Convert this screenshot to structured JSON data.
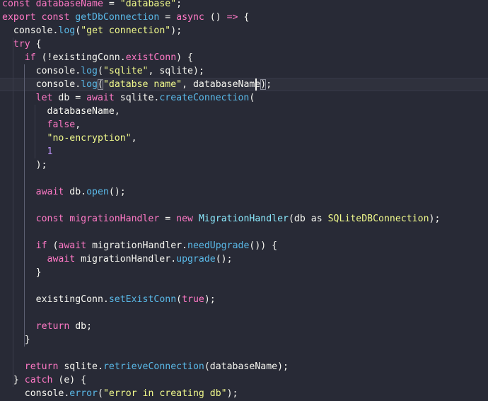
{
  "editor": {
    "colors": {
      "background": "#282a36",
      "keyword": "#ff79c6",
      "variable": "#ff79c6",
      "string": "#f1fa8c",
      "function": "#5ab9e8",
      "class": "#8be9fd",
      "plain": "#f8f8f2",
      "boolean": "#bd93f9",
      "punctuation": "#f8f8f2"
    },
    "lines": [
      [
        {
          "t": "const ",
          "c": "keyword"
        },
        {
          "t": "databaseName",
          "c": "variable"
        },
        {
          "t": " = ",
          "c": "plain"
        },
        {
          "t": "\"database\"",
          "c": "string"
        },
        {
          "t": ";",
          "c": "plain"
        }
      ],
      [
        {
          "t": "export",
          "c": "keyword"
        },
        {
          "t": " const ",
          "c": "keyword"
        },
        {
          "t": "getDbConnection",
          "c": "function"
        },
        {
          "t": " = ",
          "c": "plain"
        },
        {
          "t": "async",
          "c": "keyword"
        },
        {
          "t": " () ",
          "c": "plain"
        },
        {
          "t": "=>",
          "c": "keyword"
        },
        {
          "t": " {",
          "c": "plain"
        }
      ],
      [
        {
          "t": "  console",
          "c": "plain"
        },
        {
          "t": ".",
          "c": "plain"
        },
        {
          "t": "log",
          "c": "function"
        },
        {
          "t": "(",
          "c": "plain"
        },
        {
          "t": "\"get connection\"",
          "c": "string"
        },
        {
          "t": ");",
          "c": "plain"
        }
      ],
      [
        {
          "t": "  try",
          "c": "keyword"
        },
        {
          "t": " {",
          "c": "plain"
        }
      ],
      [
        {
          "t": "    if",
          "c": "keyword"
        },
        {
          "t": " (!existingConn.",
          "c": "plain"
        },
        {
          "t": "existConn",
          "c": "keyword"
        },
        {
          "t": ") {",
          "c": "plain"
        }
      ],
      [
        {
          "t": "      console",
          "c": "plain"
        },
        {
          "t": ".",
          "c": "plain"
        },
        {
          "t": "log",
          "c": "function"
        },
        {
          "t": "(",
          "c": "plain"
        },
        {
          "t": "\"sqlite\"",
          "c": "string"
        },
        {
          "t": ", sqlite);",
          "c": "plain"
        }
      ],
      [
        {
          "t": "      console",
          "c": "plain"
        },
        {
          "t": ".",
          "c": "plain"
        },
        {
          "t": "log",
          "c": "function"
        },
        {
          "t": "(",
          "c": "plain",
          "m": true
        },
        {
          "t": "\"databse name\"",
          "c": "string"
        },
        {
          "t": ", databaseName",
          "c": "plain"
        },
        {
          "t": ")",
          "c": "plain",
          "m": true
        },
        {
          "t": ";",
          "c": "plain"
        }
      ],
      [
        {
          "t": "      let",
          "c": "keyword"
        },
        {
          "t": " db = ",
          "c": "plain"
        },
        {
          "t": "await",
          "c": "keyword"
        },
        {
          "t": " sqlite.",
          "c": "plain"
        },
        {
          "t": "createConnection",
          "c": "function"
        },
        {
          "t": "(",
          "c": "plain"
        }
      ],
      [
        {
          "t": "        databaseName,",
          "c": "plain"
        }
      ],
      [
        {
          "t": "        false",
          "c": "keyword"
        },
        {
          "t": ",",
          "c": "plain"
        }
      ],
      [
        {
          "t": "        \"no-encryption\"",
          "c": "string"
        },
        {
          "t": ",",
          "c": "plain"
        }
      ],
      [
        {
          "t": "        1",
          "c": "boolean"
        }
      ],
      [
        {
          "t": "      );",
          "c": "plain"
        }
      ],
      [],
      [
        {
          "t": "      await",
          "c": "keyword"
        },
        {
          "t": " db.",
          "c": "plain"
        },
        {
          "t": "open",
          "c": "function"
        },
        {
          "t": "();",
          "c": "plain"
        }
      ],
      [],
      [
        {
          "t": "      const ",
          "c": "keyword"
        },
        {
          "t": "migrationHandler",
          "c": "variable"
        },
        {
          "t": " = ",
          "c": "plain"
        },
        {
          "t": "new",
          "c": "keyword"
        },
        {
          "t": " ",
          "c": "plain"
        },
        {
          "t": "MigrationHandler",
          "c": "class"
        },
        {
          "t": "(db ",
          "c": "plain"
        },
        {
          "t": "as",
          "c": "plain"
        },
        {
          "t": " ",
          "c": "plain"
        },
        {
          "t": "SQLiteDBConnection",
          "c": "string"
        },
        {
          "t": ");",
          "c": "plain"
        }
      ],
      [],
      [
        {
          "t": "      if",
          "c": "keyword"
        },
        {
          "t": " (",
          "c": "plain"
        },
        {
          "t": "await",
          "c": "keyword"
        },
        {
          "t": " migrationHandler.",
          "c": "plain"
        },
        {
          "t": "needUpgrade",
          "c": "function"
        },
        {
          "t": "()) {",
          "c": "plain"
        }
      ],
      [
        {
          "t": "        await",
          "c": "keyword"
        },
        {
          "t": " migrationHandler.",
          "c": "plain"
        },
        {
          "t": "upgrade",
          "c": "function"
        },
        {
          "t": "();",
          "c": "plain"
        }
      ],
      [
        {
          "t": "      }",
          "c": "plain"
        }
      ],
      [],
      [
        {
          "t": "      existingConn.",
          "c": "plain"
        },
        {
          "t": "setExistConn",
          "c": "function"
        },
        {
          "t": "(",
          "c": "plain"
        },
        {
          "t": "true",
          "c": "keyword"
        },
        {
          "t": ");",
          "c": "plain"
        }
      ],
      [],
      [
        {
          "t": "      return",
          "c": "keyword"
        },
        {
          "t": " db;",
          "c": "plain"
        }
      ],
      [
        {
          "t": "    }",
          "c": "plain"
        }
      ],
      [],
      [
        {
          "t": "    return",
          "c": "keyword"
        },
        {
          "t": " sqlite.",
          "c": "plain"
        },
        {
          "t": "retrieveConnection",
          "c": "function"
        },
        {
          "t": "(databaseName);",
          "c": "plain"
        }
      ],
      [
        {
          "t": "  } ",
          "c": "plain"
        },
        {
          "t": "catch",
          "c": "keyword"
        },
        {
          "t": " (e) {",
          "c": "plain"
        }
      ],
      [
        {
          "t": "    console",
          "c": "plain"
        },
        {
          "t": ".",
          "c": "plain"
        },
        {
          "t": "error",
          "c": "function"
        },
        {
          "t": "(",
          "c": "plain"
        },
        {
          "t": "\"error in creating db\"",
          "c": "string"
        },
        {
          "t": ");",
          "c": "plain"
        }
      ]
    ]
  }
}
